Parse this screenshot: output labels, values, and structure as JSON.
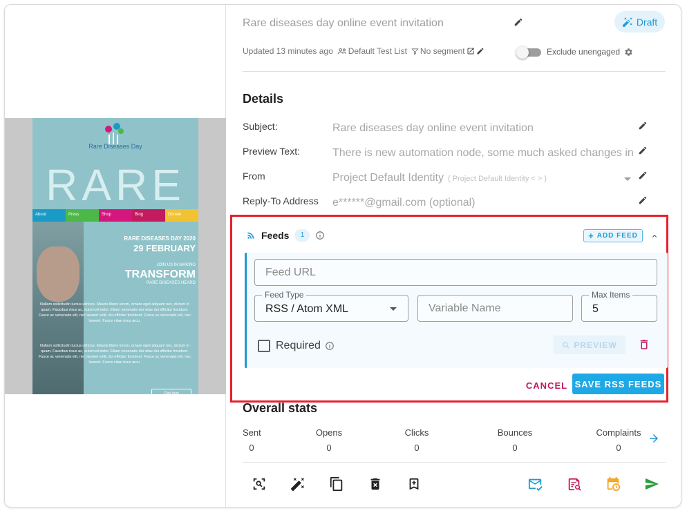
{
  "campaign": {
    "title": "Rare diseases day online event invitation",
    "status_chip": "Draft",
    "updated": "Updated 13 minutes ago",
    "list": "Default Test List",
    "segment": "No segment",
    "exclude_label": "Exclude unengaged"
  },
  "email_preview": {
    "logo_text": "Rare Diseases Day",
    "hero_word": "RARE",
    "nav": [
      {
        "label": "About",
        "color": "#1a9bc7"
      },
      {
        "label": "Press",
        "color": "#4cb848"
      },
      {
        "label": "Shop",
        "color": "#d4177f"
      },
      {
        "label": "Blog",
        "color": "#c21b5e"
      },
      {
        "label": "Donate",
        "color": "#f2c230"
      }
    ],
    "headline_small": "RARE DISEASES DAY 2020",
    "headline_date": "29 FEBRUARY",
    "join_text": "JOIN US IN MAKING",
    "transform": "TRANSFORM",
    "heard": "RARE DISEASES HEARD",
    "para1": "Nullam sollicitudin luctus ultrices. Mauris libero lorem, ornare eget aliquam nec, dictum in quam. Faucibus risus ac, euismod tortor. Etiam venenatis dui vitae dui efficitur tincidunt. Fusce ac venenatis elit, nec laoreet velit, dui efficitur tincidunt. Fusce ac venenatis elit, nec laoreet. Fusce vitae risus arcu.",
    "para2": "Nullam sollicitudin luctus ultrices. Mauris libero lorem, ornare eget aliquam nec, dictum in quam. Faucibus risus ac, euismod tortor. Etiam venenatis dui vitae dui efficitur tincidunt. Fusce ac venenatis elit, nec laoreet velit, dui efficitur tincidunt. Fusce ac venenatis elit, nec laoreet. Fusce vitae risus arcu.",
    "cta": "Click here"
  },
  "details": {
    "heading": "Details",
    "rows": [
      {
        "label": "Subject:",
        "value": "Rare diseases day online event invitation"
      },
      {
        "label": "Preview Text:",
        "value": "There is new automation node, some much asked changes in"
      },
      {
        "label": "From",
        "value": "Project Default Identity",
        "sub": "( Project Default Identity < > )"
      },
      {
        "label": "Reply-To Address",
        "value": "e******@gmail.com (optional)"
      }
    ]
  },
  "feeds": {
    "title": "Feeds",
    "count": "1",
    "add_label": "ADD FEED",
    "url_placeholder": "Feed URL",
    "type_legend": "Feed Type",
    "type_value": "RSS / Atom XML",
    "variable_placeholder": "Variable Name",
    "max_legend": "Max Items",
    "max_value": "5",
    "required_label": "Required",
    "preview_label": "PREVIEW",
    "cancel_label": "CANCEL",
    "save_label": "SAVE RSS FEEDS"
  },
  "stats": {
    "heading": "Overall stats",
    "items": [
      {
        "label": "Sent",
        "value": "0"
      },
      {
        "label": "Opens",
        "value": "0"
      },
      {
        "label": "Clicks",
        "value": "0"
      },
      {
        "label": "Bounces",
        "value": "0"
      },
      {
        "label": "Complaints",
        "value": "0"
      }
    ]
  },
  "toolbar_icons": [
    "zoom-preview-icon",
    "magic-wand-icon",
    "copy-icon",
    "delete-icon",
    "bookmark-icon",
    "test-email-icon",
    "review-icon",
    "schedule-icon",
    "send-icon"
  ],
  "colors": {
    "accent": "#1e9ad6",
    "highlight_border": "#e5202c",
    "danger": "#c2185b",
    "schedule": "#f5a623",
    "send": "#2e9e3e"
  }
}
